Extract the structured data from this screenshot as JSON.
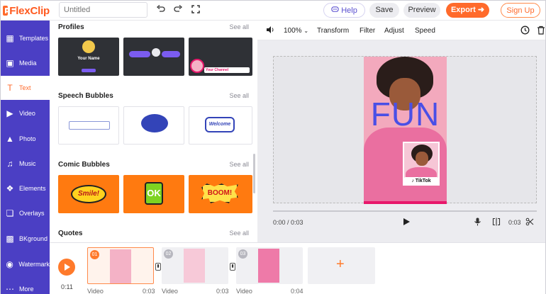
{
  "app": {
    "name": "FlexClip",
    "brand_color": "#ff6a2b",
    "nav_color": "#4b3fc4"
  },
  "topbar": {
    "title_placeholder": "Untitled",
    "help": "Help",
    "save": "Save",
    "preview": "Preview",
    "export": "Export",
    "signup": "Sign Up",
    "icons": [
      "undo-icon",
      "redo-icon",
      "fullscreen-icon",
      "help-icon",
      "arrow-right-icon"
    ]
  },
  "nav": [
    {
      "label": "Templates",
      "icon": "templates-icon"
    },
    {
      "label": "Media",
      "icon": "media-icon"
    },
    {
      "label": "Text",
      "icon": "text-icon",
      "active": true
    },
    {
      "label": "Video",
      "icon": "video-icon"
    },
    {
      "label": "Photo",
      "icon": "photo-icon"
    },
    {
      "label": "Music",
      "icon": "music-icon"
    },
    {
      "label": "Elements",
      "icon": "elements-icon"
    },
    {
      "label": "Overlays",
      "icon": "overlays-icon"
    },
    {
      "label": "BKground",
      "icon": "background-icon"
    },
    {
      "label": "Watermark",
      "icon": "watermark-icon"
    },
    {
      "label": "More",
      "icon": "more-icon"
    }
  ],
  "panel": {
    "see_all": "See all",
    "sections": [
      {
        "title": "Profiles",
        "thumb_texts": [
          "Your Name",
          "Your Channel"
        ]
      },
      {
        "title": "Speech Bubbles",
        "thumb_texts": [
          "Welcome"
        ]
      },
      {
        "title": "Comic Bubbles",
        "thumb_texts": [
          "Smile!",
          "OK",
          "BOOM!"
        ]
      },
      {
        "title": "Quotes"
      }
    ]
  },
  "editor_toolbar": {
    "zoom": "100%",
    "items": [
      "Transform",
      "Filter",
      "Adjust",
      "Speed"
    ]
  },
  "stage": {
    "overlay_text": "FUN",
    "badge": "TikTok",
    "time_current": "0:00 / 0:03",
    "duration": "0:03"
  },
  "timeline": {
    "elapsed": "0:11",
    "clips": [
      {
        "num": "01",
        "label": "Video",
        "duration": "0:03",
        "active": true
      },
      {
        "num": "02",
        "label": "Video",
        "duration": "0:03"
      },
      {
        "num": "03",
        "label": "Video",
        "duration": "0:04"
      }
    ],
    "add_symbol": "+"
  }
}
